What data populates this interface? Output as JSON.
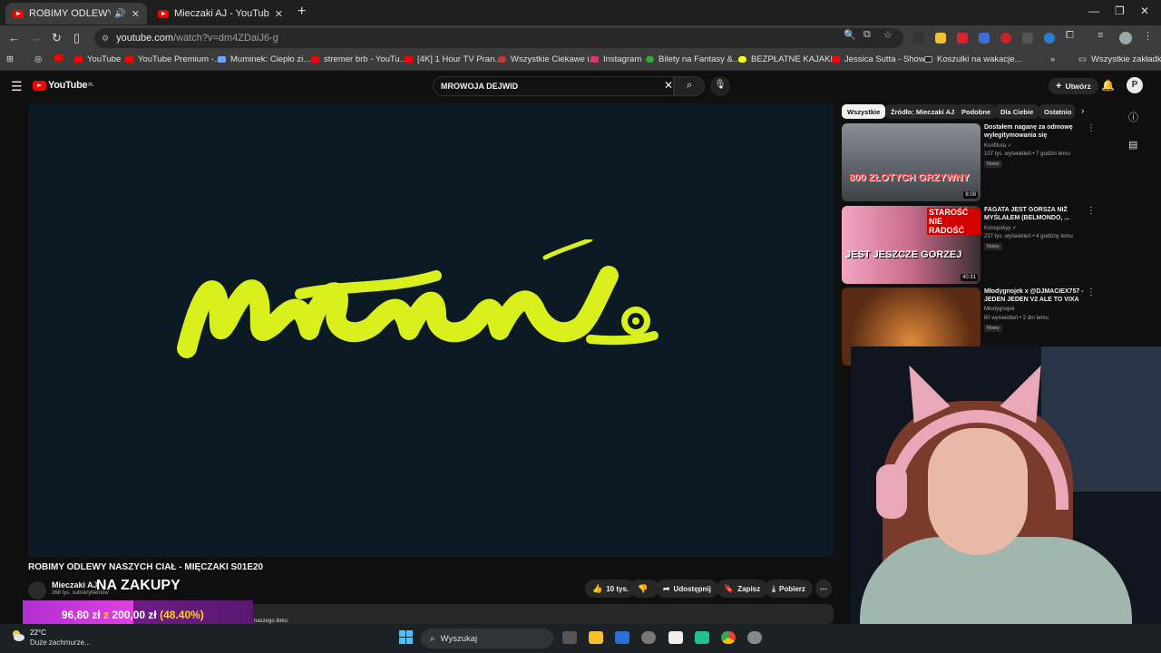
{
  "browser": {
    "tabs": [
      {
        "title": "ROBIMY ODLEWY NASZYCH",
        "active": true
      },
      {
        "title": "Mieczaki AJ - YouTube",
        "active": false
      }
    ],
    "url_host": "youtube.com",
    "url_path": "/watch?v=dm4ZDaiJ6-g",
    "bookmarks": [
      "YouTube",
      "YouTube Premium -...",
      "Muminek: Ciepło zi...",
      "stremer brb - YouTu...",
      "[4K] 1 Hour TV Pran...",
      "Wszystkie Ciekawe i...",
      "Instagram",
      "Bilety na Fantasy &...",
      "BEZPŁATNE KAJAKI...",
      "Jessica Sutta - Show...",
      "Koszulki na wakacje..."
    ],
    "all_bookmarks": "Wszystkie zakładki"
  },
  "youtube": {
    "logo": "YouTube",
    "logo_region": "PL",
    "search_query": "MROWOJA DEJWID",
    "create_label": "Utwórz",
    "video_title": "ROBIMY ODLEWY NASZYCH CIAŁ - MIĘCZAKI S01E20",
    "channel_name": "Mieczaki AJ",
    "channel_subs": "268 tys. subskrybentów",
    "overlay_text": "NA ZAKUPY",
    "likes": "10 tys.",
    "share_label": "Udostępnij",
    "save_label": "Zapisz",
    "download_label": "Pobierz",
    "desc_snippet": "naszego linku:",
    "chips": [
      "Wszystkie",
      "Źródło: Mieczaki AJ",
      "Podobne",
      "Dla Ciebie",
      "Ostatnio"
    ],
    "recommendations": [
      {
        "title": "Dostałem naganę za odmowę wylegitymowania się",
        "channel": "Konfitura ✓",
        "views": "107 tys. wyświetleń • 7 godzin temu",
        "badge": "Nowy",
        "duration": "8:09",
        "thumb_text": "800 ZŁOTYCH GRZYWNY"
      },
      {
        "title": "FAGATA JEST GORSZA NIŻ MYŚLAŁEM (BELMONDO, ...",
        "channel": "Konopskyy ✓",
        "views": "237 tys. wyświetleń • 4 godziny temu",
        "badge": "Nowy",
        "duration": "40:31",
        "thumb_text": "JEST JESZCZE GORZEJ",
        "thumb_tag": "STAROŚĆ NIE RADOŚĆ"
      },
      {
        "title": "Młodygnojek x @DJMACIEX757 - JEDEN JEDEN V2 ALE TO VIXA",
        "channel": "Młodygnojek",
        "views": "80 wyświetleń • 2 dni temu",
        "badge": "Nowy",
        "duration": ""
      }
    ]
  },
  "donation": {
    "current": "96,80 zł",
    "sep": "z",
    "target": "200,00 zł",
    "percent": "(48.40%)",
    "progress": 0.484
  },
  "taskbar": {
    "temp": "22°C",
    "weather": "Duże zachmurze...",
    "search": "Wyszukaj"
  },
  "colors": {
    "accent_yellow": "#d9f01c",
    "yt_red": "#ff0000",
    "goal_purple": "#b12fd1"
  }
}
